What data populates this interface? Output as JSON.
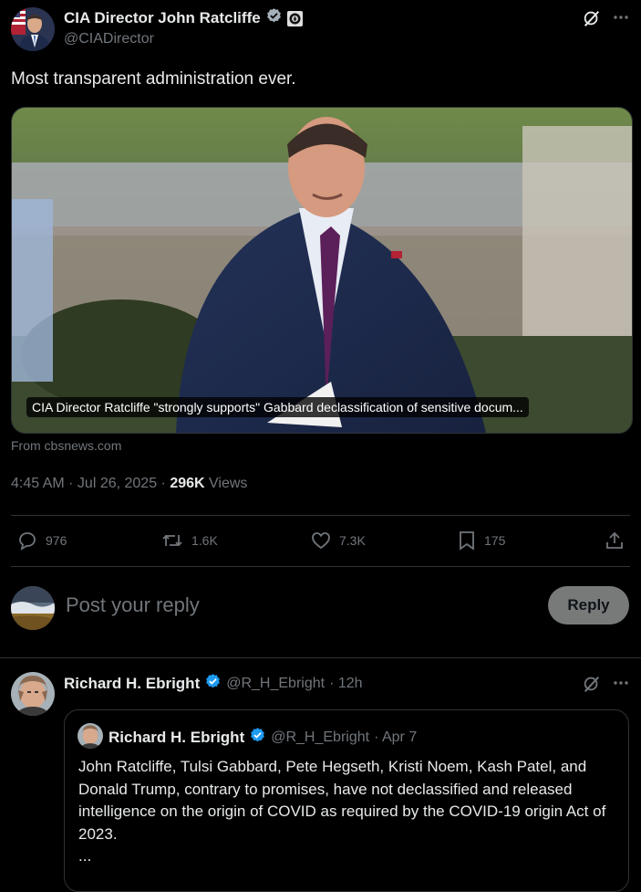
{
  "tweet": {
    "author_name": "CIA Director John Ratcliffe",
    "author_handle": "@CIADirector",
    "text": "Most transparent administration ever.",
    "card": {
      "caption": "CIA Director Ratcliffe \"strongly supports\" Gabbard declassification of sensitive docum...",
      "source": "From cbsnews.com"
    },
    "meta": {
      "time_date": "4:45 AM · Jul 26, 2025 · ",
      "views_count": "296K",
      "views_label": " Views"
    },
    "actions": {
      "replies": "976",
      "reposts": "1.6K",
      "likes": "7.3K",
      "bookmarks": "175"
    }
  },
  "reply_box": {
    "placeholder": "Post your reply",
    "button_label": "Reply"
  },
  "reply": {
    "author_name": "Richard H. Ebright",
    "author_handle": "@R_H_Ebright",
    "time": "· 12h",
    "quote": {
      "author_name": "Richard H. Ebright",
      "author_handle": "@R_H_Ebright",
      "time": "· Apr 7",
      "text": "John Ratcliffe, Tulsi Gabbard, Pete Hegseth, Kristi Noem, Kash Patel, and Donald Trump, contrary to promises, have not declassified and released intelligence on the origin of COVID as required by the COVID-19 origin Act of 2023.",
      "more": "..."
    }
  },
  "colors": {
    "background": "#000000",
    "text": "#e7e9ea",
    "muted": "#71767b",
    "divider": "#2f3336",
    "verified": "#1d9bf0",
    "reply_button": "#787a7a"
  }
}
